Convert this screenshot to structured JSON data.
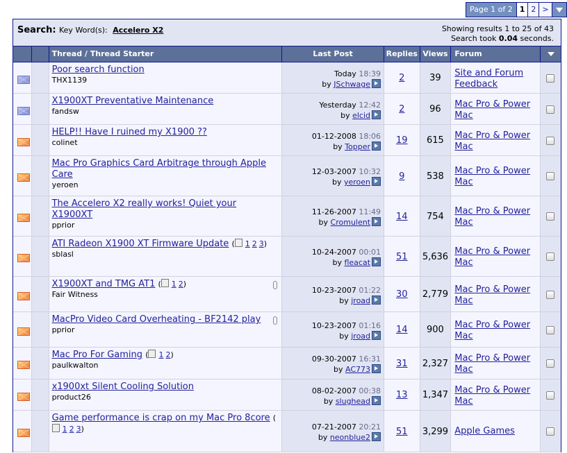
{
  "pagination": {
    "label": "Page 1 of 2",
    "current": "1",
    "next_page": "2",
    "next_arrow": ">"
  },
  "search": {
    "title": "Search:",
    "keyword_label": "Key Word(s):",
    "keyword": "Accelero X2",
    "results_text": "Showing results 1 to 25 of 43",
    "took_prefix": "Search took",
    "took_value": "0.04",
    "took_suffix": "seconds."
  },
  "columns": {
    "thread": "Thread / Thread Starter",
    "last_post": "Last Post",
    "replies": "Replies",
    "views": "Views",
    "forum": "Forum"
  },
  "rows": [
    {
      "icon": "blue",
      "title": "Poor search function",
      "starter": "THX1139",
      "pages": [],
      "date": "Today",
      "time": "18:39",
      "by": "by",
      "user": "JSchwage",
      "replies": "2",
      "views": "39",
      "forum": "Site and Forum Feedback",
      "attach": false
    },
    {
      "icon": "blue",
      "title": "X1900XT Preventative Maintenance",
      "starter": "fandsw",
      "pages": [],
      "date": "Yesterday",
      "time": "12:42",
      "by": "by",
      "user": "elcid",
      "replies": "2",
      "views": "96",
      "forum": "Mac Pro & Power Mac",
      "attach": false
    },
    {
      "icon": "orange",
      "title": "HELP!! Have I ruined my X1900 ??",
      "starter": "colinet",
      "pages": [],
      "date": "01-12-2008",
      "time": "18:06",
      "by": "by",
      "user": "Topper",
      "replies": "19",
      "views": "615",
      "forum": "Mac Pro & Power Mac",
      "attach": false
    },
    {
      "icon": "orange",
      "title": "Mac Pro Graphics Card Arbitrage through Apple Care",
      "starter": "yeroen",
      "pages": [],
      "date": "12-03-2007",
      "time": "10:32",
      "by": "by",
      "user": "yeroen",
      "replies": "9",
      "views": "538",
      "forum": "Mac Pro & Power Mac",
      "attach": false
    },
    {
      "icon": "orange",
      "title": "The Accelero X2 really works! Quiet your X1900XT",
      "starter": "pprior",
      "pages": [],
      "date": "11-26-2007",
      "time": "11:49",
      "by": "by",
      "user": "Cromulent",
      "replies": "14",
      "views": "754",
      "forum": "Mac Pro & Power Mac",
      "attach": false
    },
    {
      "icon": "orange",
      "title": "ATI Radeon X1900 XT Firmware Update",
      "starter": "sblasl",
      "pages": [
        "1",
        "2",
        "3"
      ],
      "date": "10-24-2007",
      "time": "00:01",
      "by": "by",
      "user": "fleacat",
      "replies": "51",
      "views": "5,636",
      "forum": "Mac Pro & Power Mac",
      "attach": false
    },
    {
      "icon": "orange",
      "title": "X1900XT and TMG AT1",
      "starter": "Fair Witness",
      "pages": [
        "1",
        "2"
      ],
      "date": "10-23-2007",
      "time": "01:22",
      "by": "by",
      "user": "jroad",
      "replies": "30",
      "views": "2,779",
      "forum": "Mac Pro & Power Mac",
      "attach": true
    },
    {
      "icon": "orange",
      "title": "MacPro Video Card Overheating - BF2142 play",
      "starter": "pprior",
      "pages": [],
      "date": "10-23-2007",
      "time": "01:16",
      "by": "by",
      "user": "jroad",
      "replies": "14",
      "views": "900",
      "forum": "Mac Pro & Power Mac",
      "attach": true
    },
    {
      "icon": "orange",
      "title": "Mac Pro For Gaming",
      "starter": "paulkwalton",
      "pages": [
        "1",
        "2"
      ],
      "date": "09-30-2007",
      "time": "16:31",
      "by": "by",
      "user": "AC773",
      "replies": "31",
      "views": "2,327",
      "forum": "Mac Pro & Power Mac",
      "attach": false
    },
    {
      "icon": "orange",
      "title": "x1900xt Silent Cooling Solution",
      "starter": "product26",
      "pages": [],
      "date": "08-02-2007",
      "time": "00:38",
      "by": "by",
      "user": "slughead",
      "replies": "13",
      "views": "1,347",
      "forum": "Mac Pro & Power Mac",
      "attach": false
    },
    {
      "icon": "orange",
      "title": "Game performance is crap on my Mac Pro 8core",
      "starter": "",
      "pages": [
        "1",
        "2",
        "3"
      ],
      "date": "07-21-2007",
      "time": "20:21",
      "by": "by",
      "user": "neonblue2",
      "replies": "51",
      "views": "3,299",
      "forum": "Apple Games",
      "attach": false
    }
  ]
}
